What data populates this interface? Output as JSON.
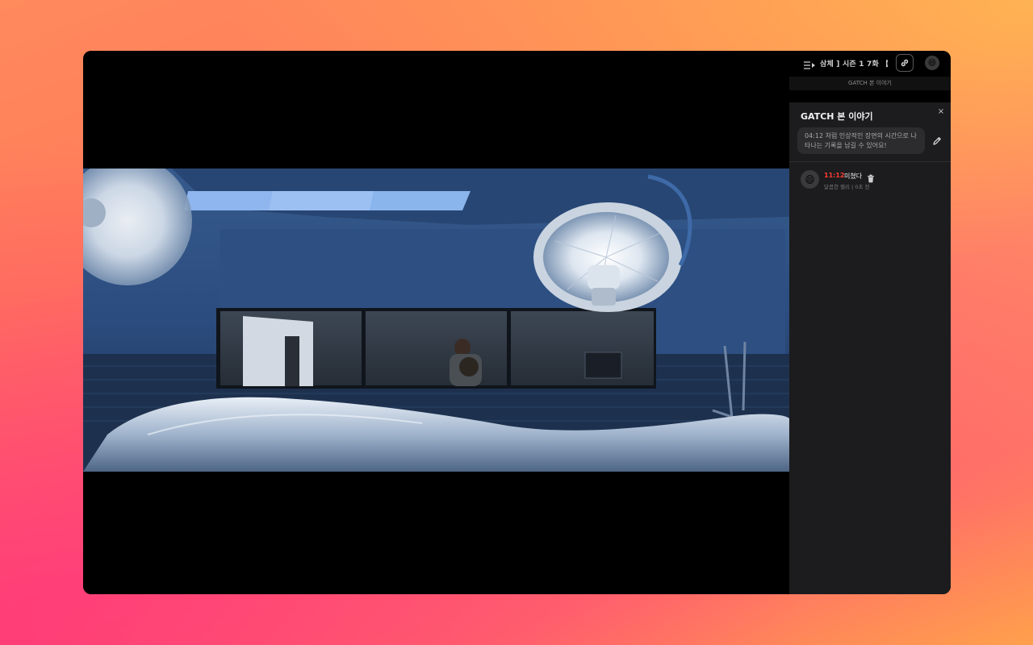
{
  "header": {
    "episode_title": "삼체 ] 시즌 1 7화 【《",
    "link_icon": "link-icon",
    "avatar": "😄"
  },
  "tab": {
    "label": "GATCH 본 이야기"
  },
  "panel": {
    "title": "GATCH 본 이야기",
    "close_label": "×",
    "input_placeholder": "04:12 처럼 인상적인 장면의 시간으로 나타나는 기록을 남길 수 있어요!"
  },
  "comments": [
    {
      "avatar": "😄",
      "time": "11:12",
      "text": "미쳤다",
      "author": "달콤한 젤리",
      "separator": "|",
      "ago": "0초 전"
    }
  ],
  "colors": {
    "accent_red": "#ff3b30",
    "panel_bg": "#1c1c1e",
    "input_bg": "#2c2c2e"
  }
}
